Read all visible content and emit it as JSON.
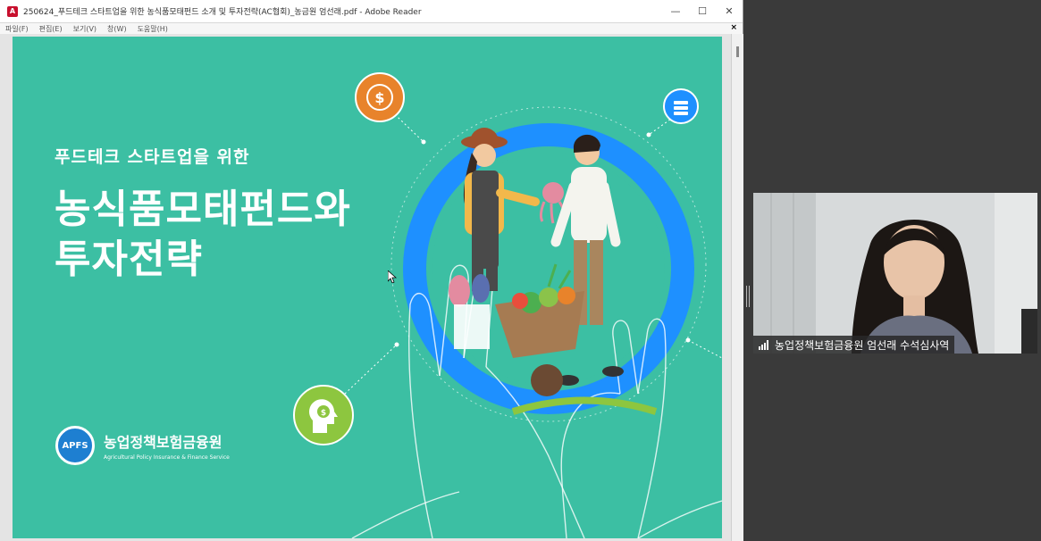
{
  "window": {
    "title": "250624_푸드테크 스타트업을 위한 농식품모태펀드 소개 및 투자전략(AC협회)_농금원 엄선래.pdf - Adobe Reader",
    "icon": "pdf-icon",
    "controls": [
      "—",
      "☐",
      "✕"
    ]
  },
  "menu": [
    "파일(F)",
    "편집(E)",
    "보기(V)",
    "창(W)",
    "도움말(H)"
  ],
  "doc_close": "×",
  "slide": {
    "subtitle": "푸드테크 스타트업을 위한",
    "title_line1": "농식품모태펀드와",
    "title_line2": "투자전략",
    "logo_badge": "APFS",
    "logo_kr": "농업정책보험금융원",
    "logo_en": "Agricultural Policy Insurance & Finance Service",
    "icons": [
      "globe-dollar-icon",
      "coins-icon",
      "head-dollar-icon"
    ],
    "colors": {
      "background": "#3cbfa3",
      "accent_blue": "#1e90ff",
      "orange": "#e8832b",
      "green": "#8dc63f"
    }
  },
  "webcam": {
    "label": "농업정책보험금융원 엄선래 수석심사역"
  }
}
